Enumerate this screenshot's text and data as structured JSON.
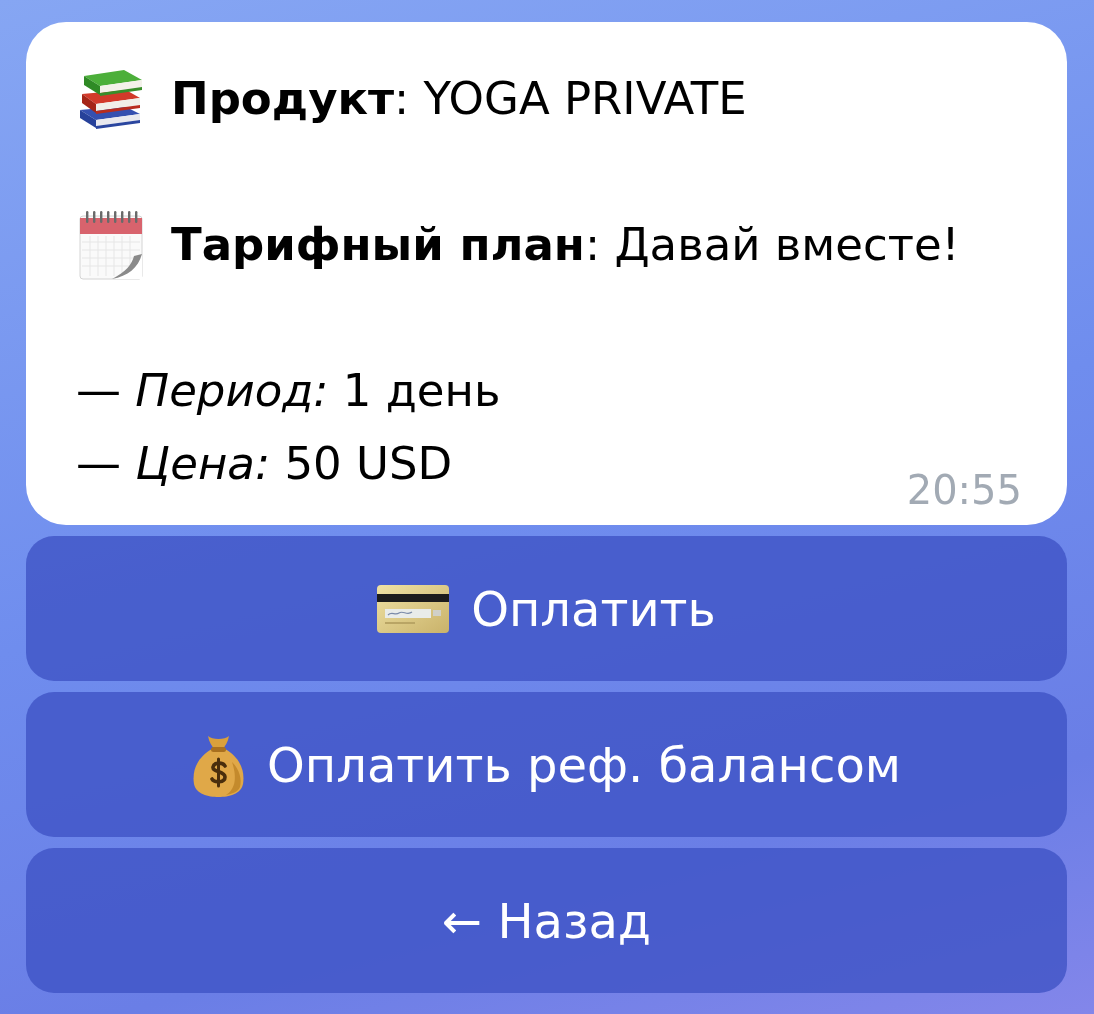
{
  "message": {
    "fields": [
      "**Продукт**: YOGA PRIVATE",
      "**Тарифный план**: Давай вместе!"
    ],
    "details": [
      "— *Период:* 1 день",
      "— *Цена:* 50 USD"
    ],
    "time": "20:55"
  },
  "buttons": [
    "Оплатить",
    "Оплатить реф. балансом",
    "← Назад"
  ]
}
